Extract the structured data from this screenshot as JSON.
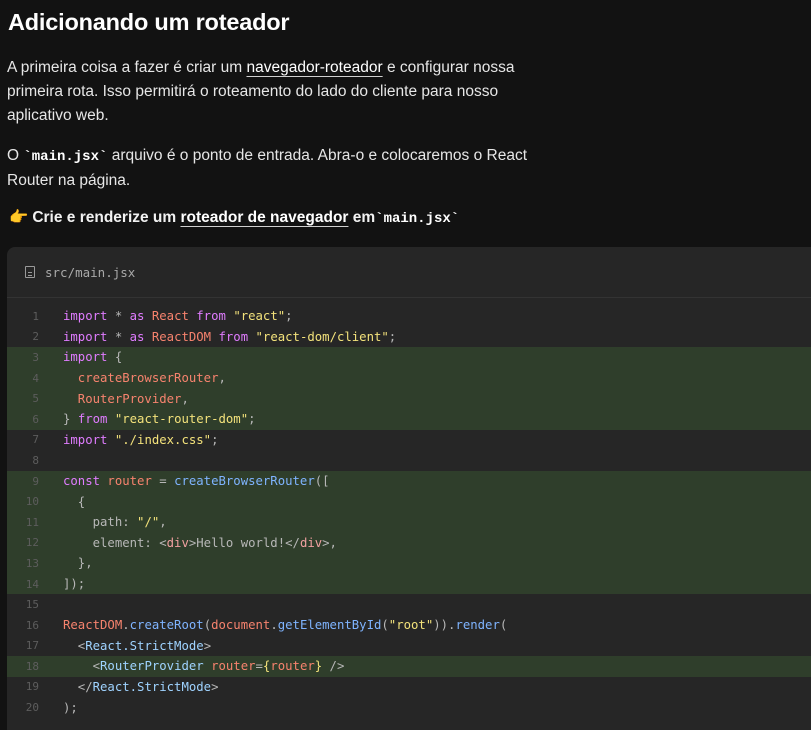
{
  "title": "Adicionando um roteador",
  "para1": {
    "pre": "A primeira coisa a fazer é criar um ",
    "link": "navegador-roteador",
    "post": " e configurar nossa primeira rota. Isso permitirá o roteamento do lado do cliente para nosso aplicativo web."
  },
  "para2": {
    "pre": "O ",
    "code": "`main.jsx`",
    "post": " arquivo é o ponto de entrada. Abra-o e colocaremos o React Router na página."
  },
  "step": {
    "emoji": "👉",
    "pre": "Crie e renderize um ",
    "link": "roteador de navegador",
    "mid": " em",
    "code": "`main.jsx`"
  },
  "file": {
    "name": "src/main.jsx",
    "icon": "file-icon"
  },
  "colors": {
    "highlight": "#2f3e2b",
    "keyword": "#e07cff",
    "string": "#f3e27b",
    "identifier": "#f7836e",
    "function": "#7fb4ff"
  },
  "code_lines": [
    {
      "n": "1",
      "hl": false,
      "tokens": [
        [
          "k",
          "import"
        ],
        [
          "o",
          " * "
        ],
        [
          "k",
          "as "
        ],
        [
          "r",
          "React "
        ],
        [
          "k",
          "from "
        ],
        [
          "s",
          "\"react\""
        ],
        [
          "o",
          ";"
        ]
      ]
    },
    {
      "n": "2",
      "hl": false,
      "tokens": [
        [
          "k",
          "import"
        ],
        [
          "o",
          " * "
        ],
        [
          "k",
          "as "
        ],
        [
          "r",
          "ReactDOM "
        ],
        [
          "k",
          "from "
        ],
        [
          "s",
          "\"react-dom/client\""
        ],
        [
          "o",
          ";"
        ]
      ]
    },
    {
      "n": "3",
      "hl": true,
      "tokens": [
        [
          "k",
          "import "
        ],
        [
          "o",
          "{"
        ]
      ]
    },
    {
      "n": "4",
      "hl": true,
      "tokens": [
        [
          "r",
          "  createBrowserRouter"
        ],
        [
          "o",
          ","
        ]
      ]
    },
    {
      "n": "5",
      "hl": true,
      "tokens": [
        [
          "r",
          "  RouterProvider"
        ],
        [
          "o",
          ","
        ]
      ]
    },
    {
      "n": "6",
      "hl": true,
      "tokens": [
        [
          "o",
          "} "
        ],
        [
          "k",
          "from "
        ],
        [
          "s",
          "\"react-router-dom\""
        ],
        [
          "o",
          ";"
        ]
      ]
    },
    {
      "n": "7",
      "hl": false,
      "tokens": [
        [
          "k",
          "import "
        ],
        [
          "s",
          "\"./index.css\""
        ],
        [
          "o",
          ";"
        ]
      ]
    },
    {
      "n": "8",
      "hl": false,
      "tokens": []
    },
    {
      "n": "9",
      "hl": true,
      "tokens": [
        [
          "k",
          "const "
        ],
        [
          "r",
          "router "
        ],
        [
          "o",
          "= "
        ],
        [
          "f",
          "createBrowserRouter"
        ],
        [
          "o",
          "(["
        ]
      ]
    },
    {
      "n": "10",
      "hl": true,
      "tokens": [
        [
          "o",
          "  {"
        ]
      ]
    },
    {
      "n": "11",
      "hl": true,
      "tokens": [
        [
          "o",
          "    path: "
        ],
        [
          "s",
          "\"/\""
        ],
        [
          "o",
          ","
        ]
      ]
    },
    {
      "n": "12",
      "hl": true,
      "tokens": [
        [
          "o",
          "    element: <"
        ],
        [
          "t",
          "div"
        ],
        [
          "o",
          ">Hello world!</"
        ],
        [
          "t",
          "div"
        ],
        [
          "o",
          ">,"
        ]
      ]
    },
    {
      "n": "13",
      "hl": true,
      "tokens": [
        [
          "o",
          "  },"
        ]
      ]
    },
    {
      "n": "14",
      "hl": true,
      "tokens": [
        [
          "o",
          "]);"
        ]
      ]
    },
    {
      "n": "15",
      "hl": false,
      "tokens": []
    },
    {
      "n": "16",
      "hl": false,
      "tokens": [
        [
          "r",
          "ReactDOM"
        ],
        [
          "o",
          "."
        ],
        [
          "f",
          "createRoot"
        ],
        [
          "o",
          "("
        ],
        [
          "r",
          "document"
        ],
        [
          "o",
          "."
        ],
        [
          "f",
          "getElementById"
        ],
        [
          "o",
          "("
        ],
        [
          "s",
          "\"root\""
        ],
        [
          "o",
          "))."
        ],
        [
          "f",
          "render"
        ],
        [
          "o",
          "("
        ]
      ]
    },
    {
      "n": "17",
      "hl": false,
      "tokens": [
        [
          "o",
          "  <"
        ],
        [
          "a",
          "React.StrictMode"
        ],
        [
          "o",
          ">"
        ]
      ]
    },
    {
      "n": "18",
      "hl": true,
      "tokens": [
        [
          "o",
          "    <"
        ],
        [
          "a",
          "RouterProvider "
        ],
        [
          "r",
          "router"
        ],
        [
          "o",
          "="
        ],
        [
          "s",
          "{"
        ],
        [
          "r",
          "router"
        ],
        [
          "s",
          "}"
        ],
        [
          "o",
          " />"
        ]
      ]
    },
    {
      "n": "19",
      "hl": false,
      "tokens": [
        [
          "o",
          "  </"
        ],
        [
          "a",
          "React.StrictMode"
        ],
        [
          "o",
          ">"
        ]
      ]
    },
    {
      "n": "20",
      "hl": false,
      "tokens": [
        [
          "o",
          ");"
        ]
      ]
    }
  ]
}
